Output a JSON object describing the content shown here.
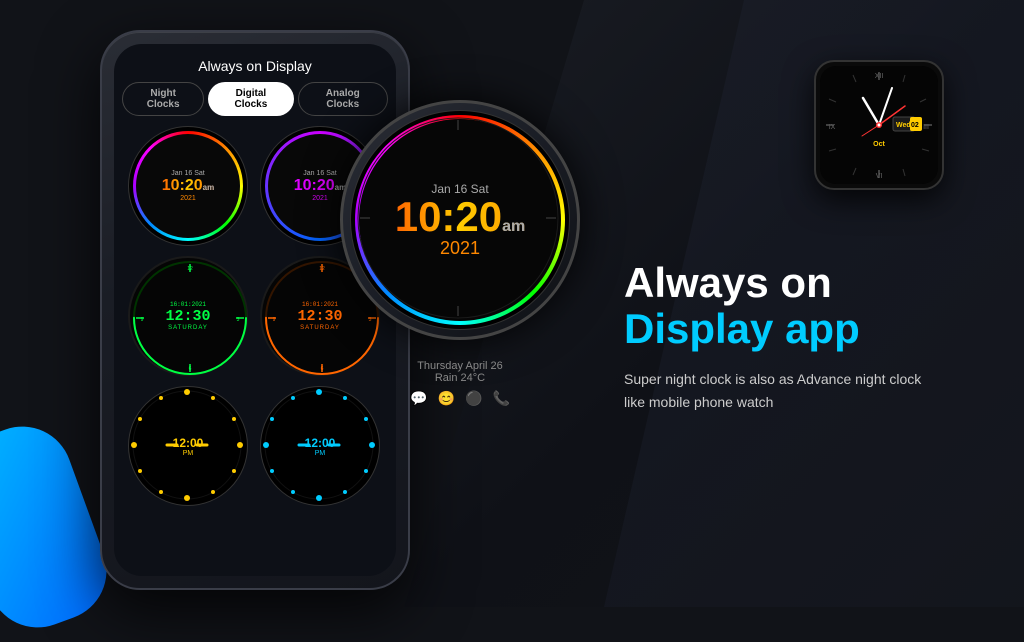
{
  "app": {
    "bg_color": "#111318"
  },
  "phone": {
    "title": "Always on Display",
    "tabs": [
      {
        "label": "Night Clocks",
        "active": false
      },
      {
        "label": "Digital Clocks",
        "active": true
      },
      {
        "label": "Analog Clocks",
        "active": false
      }
    ],
    "clocks": [
      {
        "type": "rainbow",
        "date": "Jan 16 Sat",
        "time": "10:20",
        "ampm": "am",
        "year": "2021",
        "color": "rainbow"
      },
      {
        "type": "purple",
        "date": "Jan 16 Sat",
        "time": "10:20",
        "ampm": "am",
        "year": "2021",
        "color": "purple"
      },
      {
        "type": "digital-green",
        "date": "16:01:2021",
        "time": "12:30",
        "label": "SATURDAY"
      },
      {
        "type": "digital-orange",
        "date": "16:01:2021",
        "time": "12:30",
        "label": "SATURDAY"
      },
      {
        "type": "dots-yellow",
        "time": "12:00",
        "ampm": "PM"
      },
      {
        "type": "dots-cyan",
        "time": "12:00",
        "ampm": "PM"
      }
    ]
  },
  "large_watch": {
    "date": "Jan 16 Sat",
    "time": "10:20",
    "ampm": "am",
    "year": "2021"
  },
  "watch_status": {
    "line1": "Thursday April 26",
    "line2": "Rain 24°C",
    "icons": [
      "wechat",
      "messages",
      "circle",
      "phone"
    ]
  },
  "analog_watch": {
    "day": "Wed",
    "date": "Oct",
    "date_num": "02"
  },
  "right_content": {
    "headline_line1": "Always on",
    "headline_line2": "Display app",
    "subtext": "Super night clock is also as Advance night clock like mobile phone watch"
  }
}
